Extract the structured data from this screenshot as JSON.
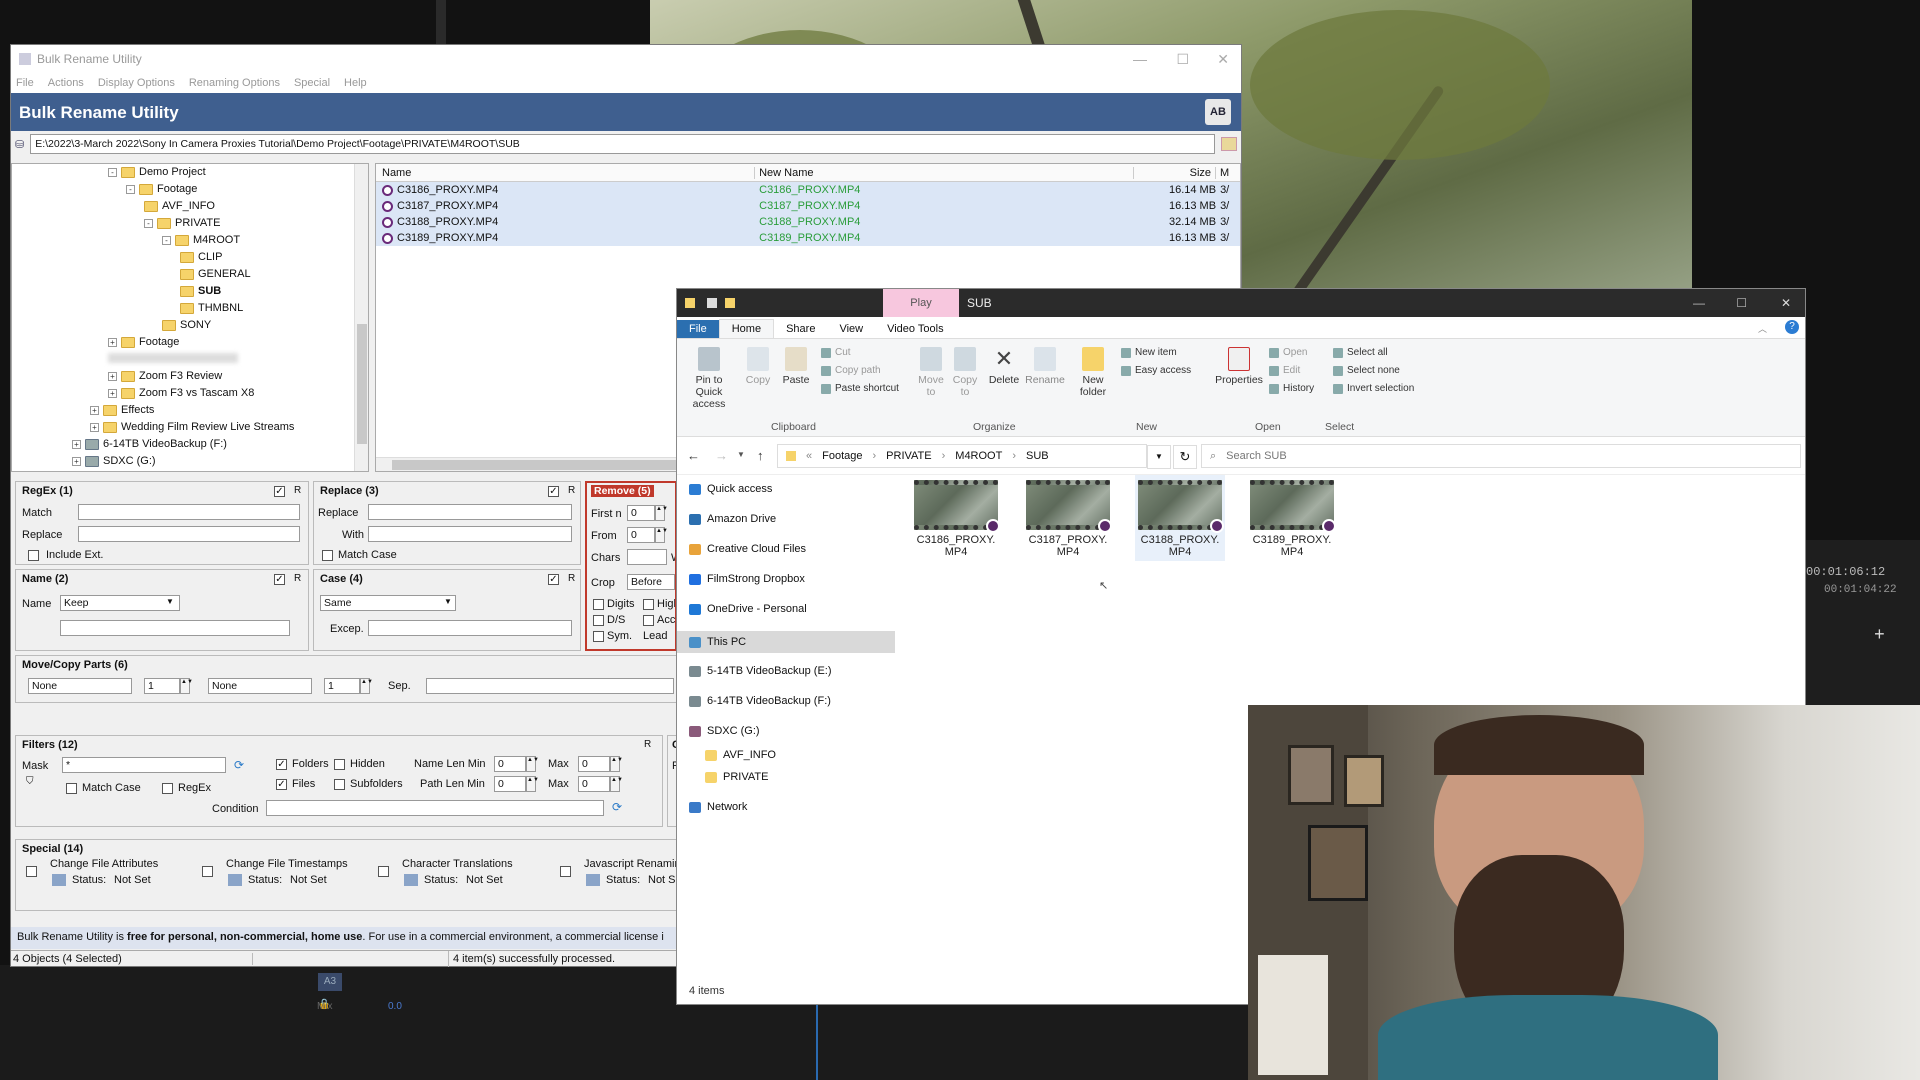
{
  "video_timecode_1": "00:01:06:12",
  "video_timecode_2": "00:01:04:22",
  "timeline": {
    "track": "A3",
    "mix_label": "Mix",
    "mix_value": "0.0"
  },
  "bru": {
    "window_title": "Bulk Rename Utility",
    "menu": [
      "File",
      "Actions",
      "Display Options",
      "Renaming Options",
      "Special",
      "Help"
    ],
    "banner": "Bulk Rename Utility",
    "logo": "AB",
    "path": "E:\\2022\\3-March 2022\\Sony In Camera Proxies Tutorial\\Demo Project\\Footage\\PRIVATE\\M4ROOT\\SUB",
    "tree": [
      {
        "label": "Demo Project",
        "level": 0,
        "exp": "-"
      },
      {
        "label": "Footage",
        "level": 1,
        "exp": "-"
      },
      {
        "label": "AVF_INFO",
        "level": 2,
        "exp": ""
      },
      {
        "label": "PRIVATE",
        "level": 2,
        "exp": "-"
      },
      {
        "label": "M4ROOT",
        "level": 3,
        "exp": "-"
      },
      {
        "label": "CLIP",
        "level": 4,
        "exp": ""
      },
      {
        "label": "GENERAL",
        "level": 4,
        "exp": ""
      },
      {
        "label": "SUB",
        "level": 4,
        "exp": "",
        "bold": true
      },
      {
        "label": "THMBNL",
        "level": 4,
        "exp": ""
      },
      {
        "label": "SONY",
        "level": 3,
        "exp": ""
      },
      {
        "label": "Footage",
        "level": 0,
        "exp": "+"
      },
      {
        "label": "",
        "level": 0,
        "exp": ""
      },
      {
        "label": "Zoom F3 Review",
        "level": 0,
        "exp": "+"
      },
      {
        "label": "Zoom F3 vs Tascam X8",
        "level": 0,
        "exp": "+"
      },
      {
        "label": "Effects",
        "level": -1,
        "exp": "+"
      },
      {
        "label": "Wedding Film Review Live Streams",
        "level": -1,
        "exp": "+"
      },
      {
        "label": "6-14TB VideoBackup (F:)",
        "level": -2,
        "exp": "+"
      },
      {
        "label": "SDXC (G:)",
        "level": -2,
        "exp": "+"
      }
    ],
    "columns": {
      "name": "Name",
      "new_name": "New Name",
      "size": "Size",
      "m": "M"
    },
    "files": [
      {
        "name": "C3186_PROXY.MP4",
        "new_name": "C3186_PROXY.MP4",
        "size": "16.14 MB",
        "m": "3/"
      },
      {
        "name": "C3187_PROXY.MP4",
        "new_name": "C3187_PROXY.MP4",
        "size": "16.13 MB",
        "m": "3/"
      },
      {
        "name": "C3188_PROXY.MP4",
        "new_name": "C3188_PROXY.MP4",
        "size": "32.14 MB",
        "m": "3/"
      },
      {
        "name": "C3189_PROXY.MP4",
        "new_name": "C3189_PROXY.MP4",
        "size": "16.13 MB",
        "m": "3/"
      }
    ],
    "regex": {
      "title": "RegEx (1)",
      "match": "Match",
      "replace": "Replace",
      "include_ext": "Include Ext.",
      "r": "R"
    },
    "replace": {
      "title": "Replace (3)",
      "replace": "Replace",
      "with": "With",
      "match_case": "Match Case",
      "r": "R"
    },
    "remove": {
      "title": "Remove (5)",
      "first_n": "First n",
      "first_n_val": "0",
      "from": "From",
      "from_val": "0",
      "chars": "Chars",
      "crop": "Crop",
      "crop_val": "Before",
      "digits": "Digits",
      "high": "High",
      "ds": "D/S",
      "acc": "Acc",
      "sym": "Sym.",
      "lead": "Lead",
      "w": "W"
    },
    "name": {
      "title": "Name (2)",
      "name": "Name",
      "value": "Keep",
      "r": "R"
    },
    "case": {
      "title": "Case (4)",
      "value": "Same",
      "excep": "Excep.",
      "r": "R"
    },
    "move": {
      "title": "Move/Copy Parts (6)",
      "sel1": "None",
      "num1": "1",
      "sel2": "None",
      "num2": "1",
      "sep": "Sep."
    },
    "filters": {
      "title": "Filters (12)",
      "mask": "Mask",
      "mask_val": "*",
      "folders": "Folders",
      "hidden": "Hidden",
      "files": "Files",
      "subfolders": "Subfolders",
      "name_len_min": "Name Len Min",
      "name_len_min_val": "0",
      "max": "Max",
      "max_val": "0",
      "path_len_min": "Path Len Min",
      "path_len_min_val": "0",
      "max2": "Max",
      "max2_val": "0",
      "match_case": "Match Case",
      "regex": "RegEx",
      "condition": "Condition",
      "r": "R",
      "cut": "Co",
      "pa": "Pa"
    },
    "special": {
      "title": "Special (14)",
      "items": [
        {
          "label": "Change File Attributes",
          "status": "Status:",
          "status_val": "Not Set"
        },
        {
          "label": "Change File Timestamps",
          "status": "Status:",
          "status_val": "Not Set"
        },
        {
          "label": "Character Translations",
          "status": "Status:",
          "status_val": "Not Set"
        },
        {
          "label": "Javascript Renaming",
          "status": "Status:",
          "status_val": "Not Set"
        }
      ]
    },
    "license_pre": "Bulk Rename Utility is ",
    "license_bold": "free for personal, non-commercial, home use",
    "license_post": ". For use in a commercial environment, a commercial license i",
    "status_left": "4 Objects (4 Selected)",
    "status_right": "4 item(s) successfully processed."
  },
  "explorer": {
    "title": "SUB",
    "play_tab": "Play",
    "tabs": [
      "File",
      "Home",
      "Share",
      "View",
      "Video Tools"
    ],
    "ribbon": {
      "pin": "Pin to Quick access",
      "copy": "Copy",
      "paste": "Paste",
      "cut": "Cut",
      "copy_path": "Copy path",
      "paste_shortcut": "Paste shortcut",
      "move_to": "Move to",
      "copy_to": "Copy to",
      "delete": "Delete",
      "rename": "Rename",
      "new_folder": "New folder",
      "new_item": "New item",
      "easy_access": "Easy access",
      "properties": "Properties",
      "open": "Open",
      "edit": "Edit",
      "history": "History",
      "select_all": "Select all",
      "select_none": "Select none",
      "invert_selection": "Invert selection",
      "groups": [
        "Clipboard",
        "Organize",
        "New",
        "Open",
        "Select"
      ]
    },
    "breadcrumb": [
      "Footage",
      "PRIVATE",
      "M4ROOT",
      "SUB"
    ],
    "search_placeholder": "Search SUB",
    "nav": [
      {
        "label": "Quick access",
        "color": "#2b7cd3"
      },
      {
        "label": "Amazon Drive",
        "color": "#2b6fb0"
      },
      {
        "label": "Creative Cloud Files",
        "color": "#e8a33a"
      },
      {
        "label": "FilmStrong Dropbox",
        "color": "#1f6fe0"
      },
      {
        "label": "OneDrive - Personal",
        "color": "#1e78d6"
      },
      {
        "label": "This PC",
        "color": "#4a90c8"
      },
      {
        "label": "5-14TB VideoBackup (E:)",
        "color": "#7a8a90"
      },
      {
        "label": "6-14TB VideoBackup (F:)",
        "color": "#7a8a90"
      },
      {
        "label": "SDXC (G:)",
        "color": "#8a5a7a"
      },
      {
        "label": "AVF_INFO",
        "color": "#f6d36a"
      },
      {
        "label": "PRIVATE",
        "color": "#f6d36a"
      },
      {
        "label": "Network",
        "color": "#3a7ac8"
      }
    ],
    "files": [
      "C3186_PROXY.MP4",
      "C3187_PROXY.MP4",
      "C3188_PROXY.MP4",
      "C3189_PROXY.MP4"
    ],
    "status": "4 items"
  }
}
